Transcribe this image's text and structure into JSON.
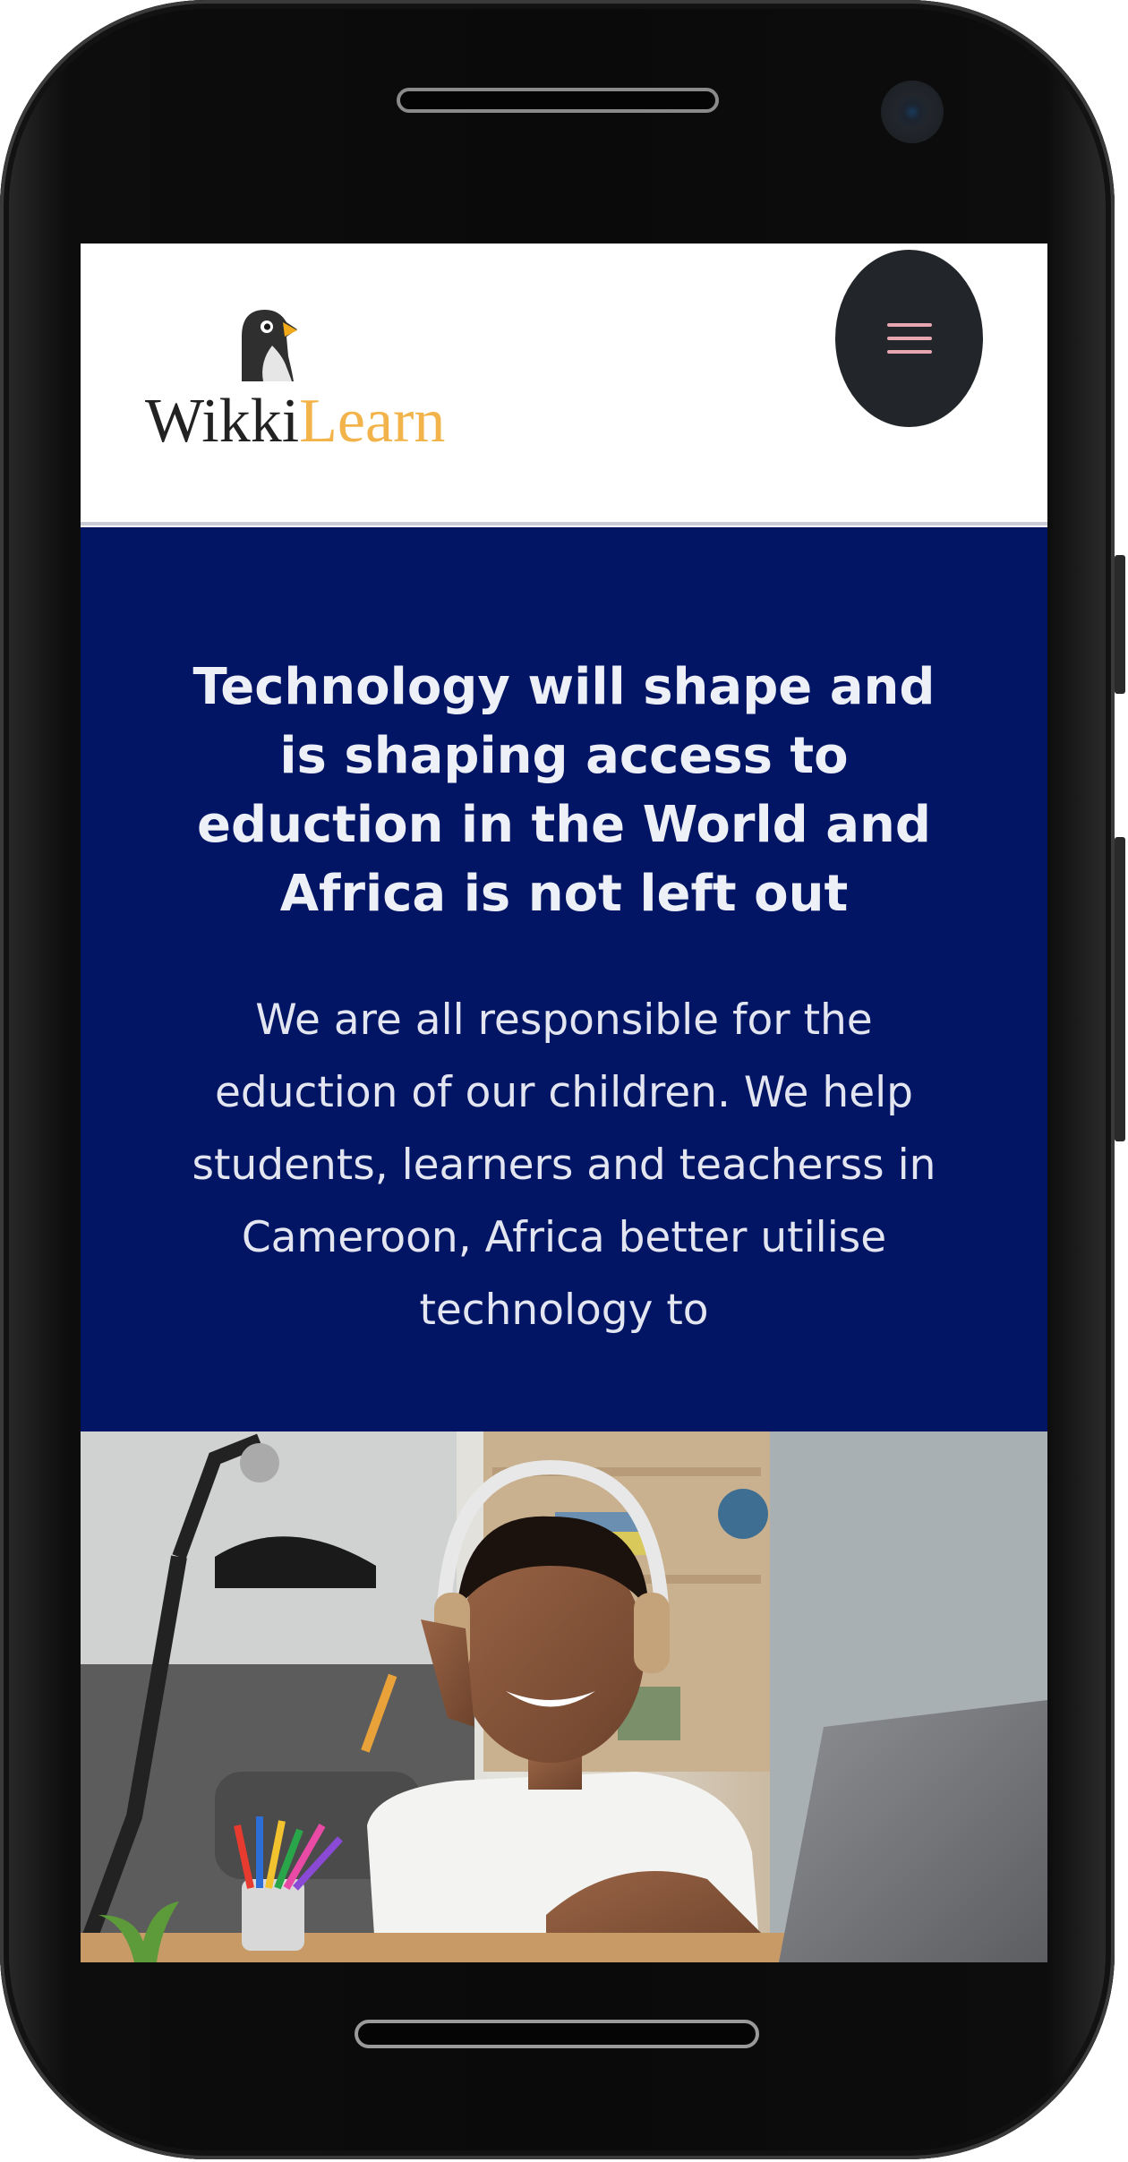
{
  "brand": {
    "name_part1": "Wikki",
    "name_part2": "Learn",
    "logo_icon": "penguin-icon",
    "primary_color": "#021565",
    "accent_color": "#f2b44a"
  },
  "header": {
    "menu_icon": "hamburger-menu-icon"
  },
  "hero": {
    "title": "Technology will shape and is shaping access to eduction in the World and Africa is not left out",
    "text": "We are all responsible for the eduction of our children. We help students, learners and teacherss in Cameroon, Africa better utilise technology to"
  },
  "photo": {
    "subject": "boy with headphones studying at a laptop"
  }
}
